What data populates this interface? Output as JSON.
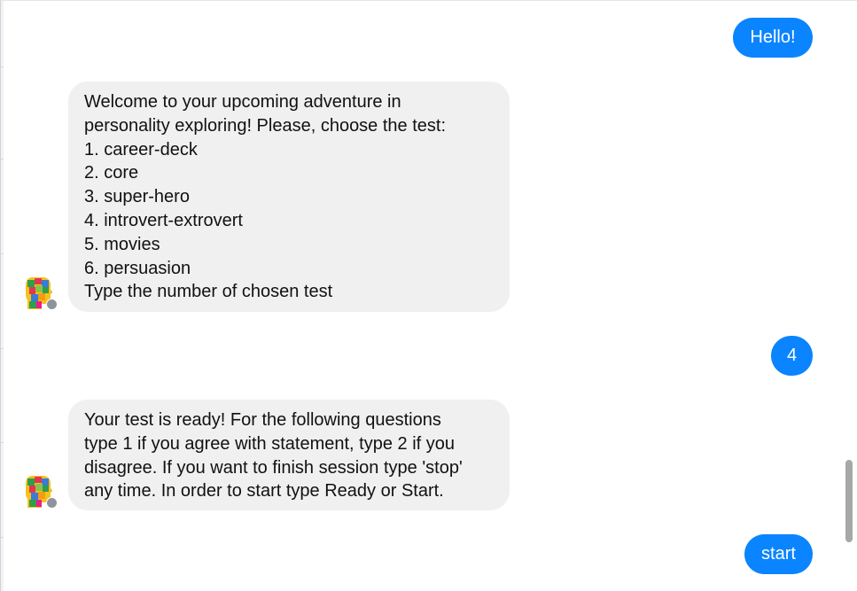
{
  "messages": [
    {
      "sender": "user",
      "text": "Hello!"
    },
    {
      "sender": "bot",
      "text": "Welcome to your upcoming adventure in\npersonality exploring! Please, choose the test:\n1. career-deck\n2. core\n3. super-hero\n4. introvert-extrovert\n5. movies\n6. persuasion\nType the number of chosen test"
    },
    {
      "sender": "user",
      "text": "4"
    },
    {
      "sender": "bot",
      "text": "Your test is ready! For the following questions\ntype 1 if you agree with statement, type 2 if you\ndisagree. If you want to finish session type 'stop'\nany time. In order to start type Ready or Start."
    },
    {
      "sender": "user",
      "text": "start"
    }
  ],
  "avatar": {
    "icon": "puzzle-head-icon",
    "badge_icon": "messenger-badge-icon"
  },
  "colors": {
    "user_bubble": "#0a84ff",
    "bot_bubble": "#f0f0f0",
    "scroll_thumb": "#a8a8a8"
  }
}
